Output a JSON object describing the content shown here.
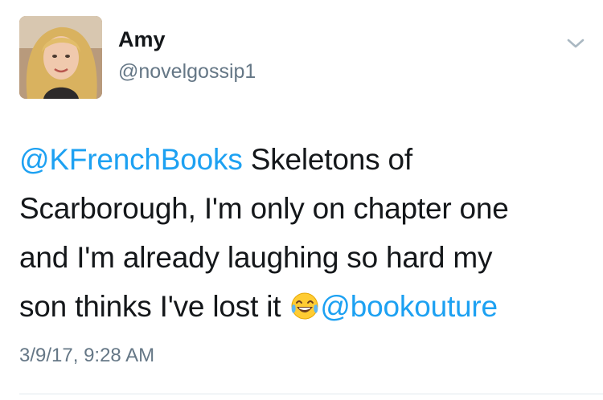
{
  "tweet": {
    "author_name": "Amy",
    "author_handle": "@novelgossip1",
    "text": {
      "mention_1": "@KFrenchBooks",
      "line_1": " Skeletons of",
      "line_2": "Scarborough, I'm only on chapter one",
      "line_3": "and I'm already laughing so hard my",
      "line_4": "son thinks I've lost it ",
      "mention_2": "@bookouture"
    },
    "emoji": "face-with-tears-of-joy-icon",
    "timestamp": "3/9/17, 9:28 AM"
  },
  "colors": {
    "mention": "#1da1f2",
    "text": "#14171a",
    "secondary": "#657786",
    "divider": "#e1e8ed"
  }
}
